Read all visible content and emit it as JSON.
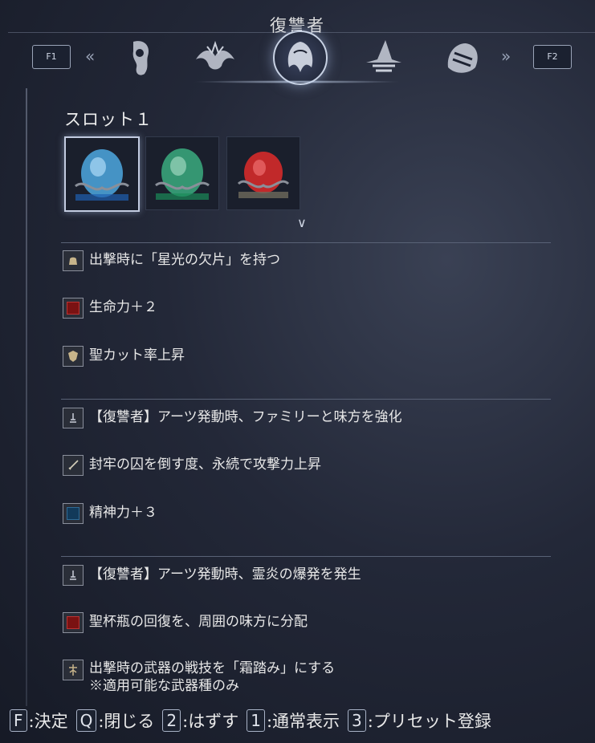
{
  "header": {
    "title": "復讐者",
    "left_key": "F1",
    "right_key": "F2",
    "left_arrow": "«",
    "right_arrow": "»",
    "characters": [
      {
        "icon": "hooded-figure-icon"
      },
      {
        "icon": "winged-beast-icon"
      },
      {
        "icon": "revenant-portrait-icon",
        "selected": true
      },
      {
        "icon": "witch-hat-icon"
      },
      {
        "icon": "armored-mask-icon"
      }
    ]
  },
  "slot": {
    "title": "スロット１",
    "relics": [
      {
        "icon": "blue-relic-icon",
        "color": "#4ea8e0",
        "selected": true
      },
      {
        "icon": "green-relic-icon",
        "color": "#3fbf8a",
        "selected": false
      },
      {
        "icon": "red-relic-icon",
        "color": "#d42a2a",
        "selected": false
      }
    ],
    "expand_icon": "chevron-down-icon"
  },
  "effect_groups": [
    [
      {
        "icon": "pouch-icon",
        "text": "出撃時に「星光の欠片」を持つ"
      },
      {
        "icon": "red-square-icon",
        "text": "生命力＋２"
      },
      {
        "icon": "holy-shield-icon",
        "text": "聖カット率上昇"
      }
    ],
    [
      {
        "icon": "arts-icon",
        "text": "【復讐者】アーツ発動時、ファミリーと味方を強化"
      },
      {
        "icon": "sword-icon",
        "text": "封牢の囚を倒す度、永続で攻撃力上昇"
      },
      {
        "icon": "blue-square-icon",
        "text": "精神力＋３"
      }
    ],
    [
      {
        "icon": "arts-icon",
        "text": "【復讐者】アーツ発動時、霊炎の爆発を発生"
      },
      {
        "icon": "red-square-icon",
        "text": "聖杯瓶の回復を、周囲の味方に分配"
      },
      {
        "icon": "weapon-skill-icon",
        "text": "出撃時の武器の戦技を「霜踏み」にする",
        "note": "※適用可能な武器種のみ"
      }
    ]
  ],
  "footer": [
    {
      "key": "F",
      "label": ":決定"
    },
    {
      "key": "Q",
      "label": ":閉じる"
    },
    {
      "key": "2",
      "label": ":はずす"
    },
    {
      "key": "1",
      "label": ":通常表示"
    },
    {
      "key": "3",
      "label": ":プリセット登録"
    }
  ]
}
